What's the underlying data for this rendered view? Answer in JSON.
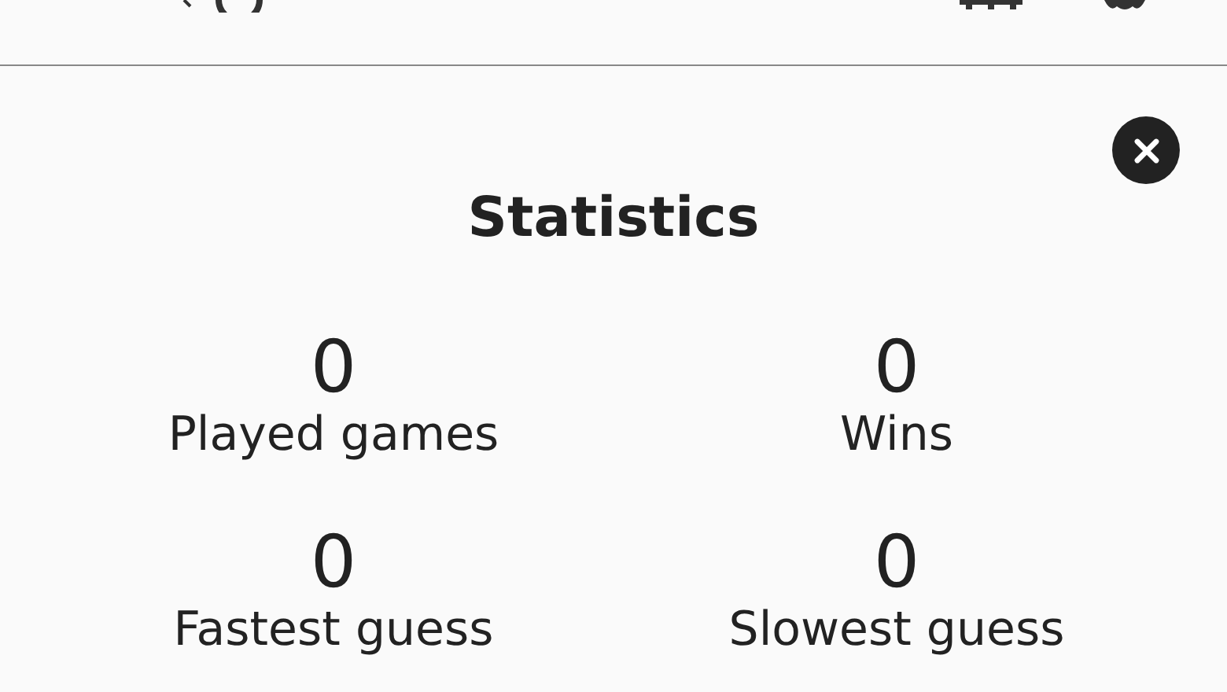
{
  "dialog": {
    "title": "Statistics"
  },
  "stats": [
    {
      "value": "0",
      "label": "Played games"
    },
    {
      "value": "0",
      "label": "Wins"
    },
    {
      "value": "0",
      "label": "Fastest guess"
    },
    {
      "value": "0",
      "label": "Slowest guess"
    }
  ]
}
